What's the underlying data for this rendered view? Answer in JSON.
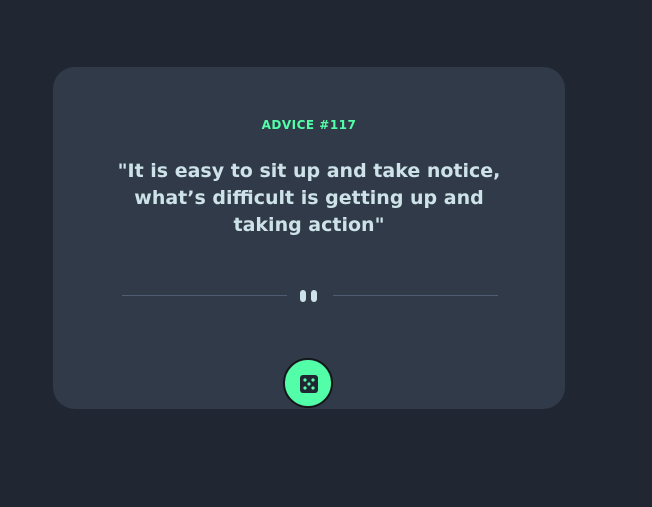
{
  "advice": {
    "label": "ADVICE #117",
    "quote": "\"It is easy to sit up and take notice, what’s difficult is getting up and taking action\""
  },
  "divider": {
    "icon": "pause-icon"
  },
  "dice_button": {
    "icon": "dice-icon"
  },
  "colors": {
    "background": "#202632",
    "card": "#313a48",
    "accent": "#52ffa8",
    "text": "#cee3e9",
    "divider": "#4f5d74"
  }
}
